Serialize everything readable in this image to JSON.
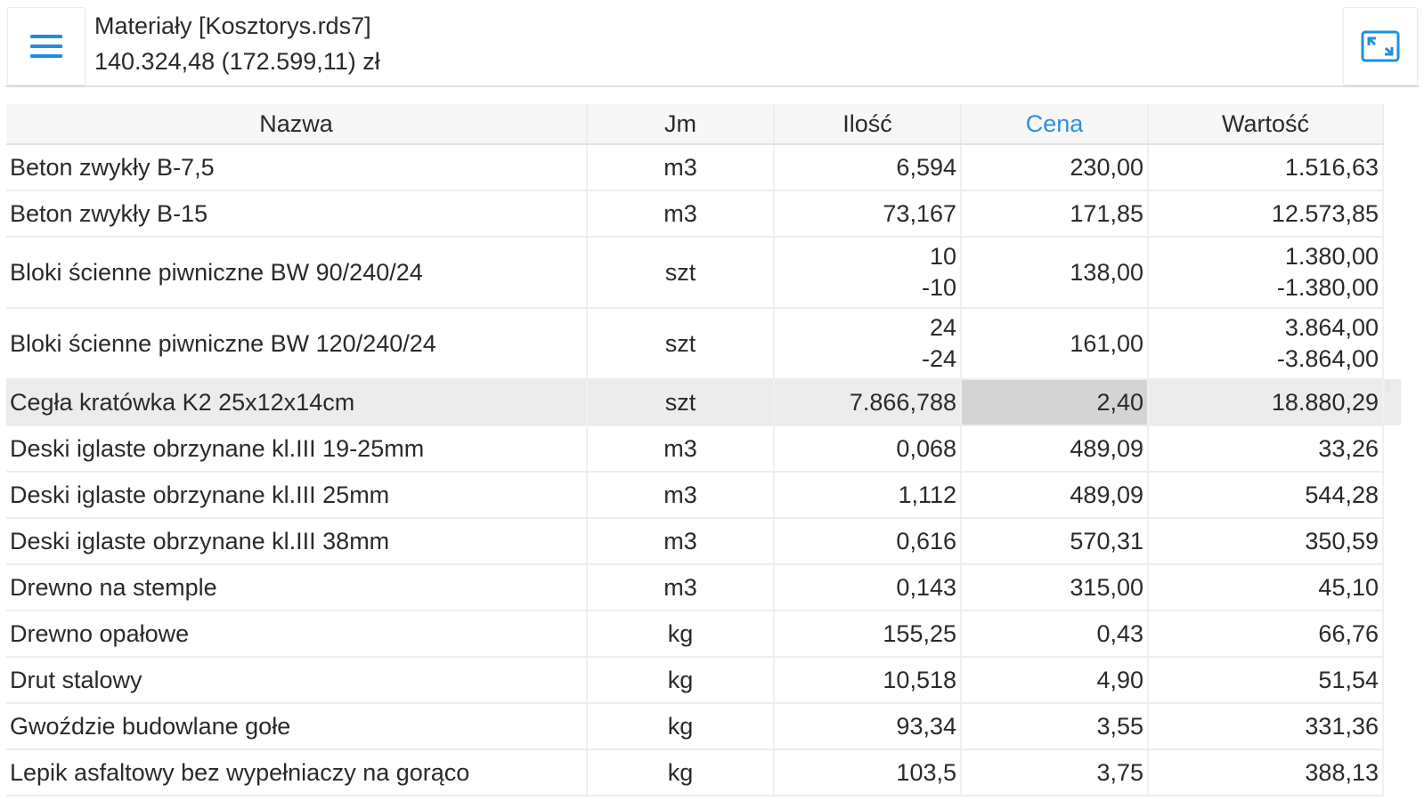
{
  "header": {
    "title": "Materiały [Kosztorys.rds7]",
    "subtitle": "140.324,48 (172.599,11) zł",
    "menu_icon": "hamburger-menu-icon",
    "expand_icon": "fullscreen-icon",
    "accent_color": "#1f8fe0"
  },
  "table": {
    "columns": {
      "name": "Nazwa",
      "jm": "Jm",
      "ilosc": "Ilość",
      "cena": "Cena",
      "wartosc": "Wartość"
    },
    "sorted_column": "cena",
    "rows": [
      {
        "name": "Beton zwykły  B-7,5",
        "jm": "m3",
        "ilosc": "6,594",
        "cena": "230,00",
        "wartosc": "1.516,63"
      },
      {
        "name": "Beton zwykły B-15",
        "jm": "m3",
        "ilosc": "73,167",
        "cena": "171,85",
        "wartosc": "12.573,85"
      },
      {
        "name": "Bloki ścienne piwniczne BW  90/240/24",
        "jm": "szt",
        "ilosc": "10",
        "ilosc2": "-10",
        "cena": "138,00",
        "wartosc": "1.380,00",
        "wartosc2": "-1.380,00"
      },
      {
        "name": "Bloki ścienne piwniczne BW 120/240/24",
        "jm": "szt",
        "ilosc": "24",
        "ilosc2": "-24",
        "cena": "161,00",
        "wartosc": "3.864,00",
        "wartosc2": "-3.864,00"
      },
      {
        "name": "Cegła kratówka K2 25x12x14cm",
        "jm": "szt",
        "ilosc": "7.866,788",
        "cena": "2,40",
        "wartosc": "18.880,29"
      },
      {
        "name": "Deski iglaste obrzynane kl.III 19-25mm",
        "jm": "m3",
        "ilosc": "0,068",
        "cena": "489,09",
        "wartosc": "33,26"
      },
      {
        "name": "Deski iglaste obrzynane kl.III 25mm",
        "jm": "m3",
        "ilosc": "1,112",
        "cena": "489,09",
        "wartosc": "544,28"
      },
      {
        "name": "Deski iglaste obrzynane kl.III 38mm",
        "jm": "m3",
        "ilosc": "0,616",
        "cena": "570,31",
        "wartosc": "350,59"
      },
      {
        "name": "Drewno na stemple",
        "jm": "m3",
        "ilosc": "0,143",
        "cena": "315,00",
        "wartosc": "45,10"
      },
      {
        "name": "Drewno opałowe",
        "jm": "kg",
        "ilosc": "155,25",
        "cena": "0,43",
        "wartosc": "66,76"
      },
      {
        "name": "Drut stalowy",
        "jm": "kg",
        "ilosc": "10,518",
        "cena": "4,90",
        "wartosc": "51,54"
      },
      {
        "name": "Gwoździe budowlane gołe",
        "jm": "kg",
        "ilosc": "93,34",
        "cena": "3,55",
        "wartosc": "331,36"
      },
      {
        "name": "Lepik asfaltowy bez wypełniaczy na gorąco",
        "jm": "kg",
        "ilosc": "103,5",
        "cena": "3,75",
        "wartosc": "388,13"
      }
    ]
  }
}
